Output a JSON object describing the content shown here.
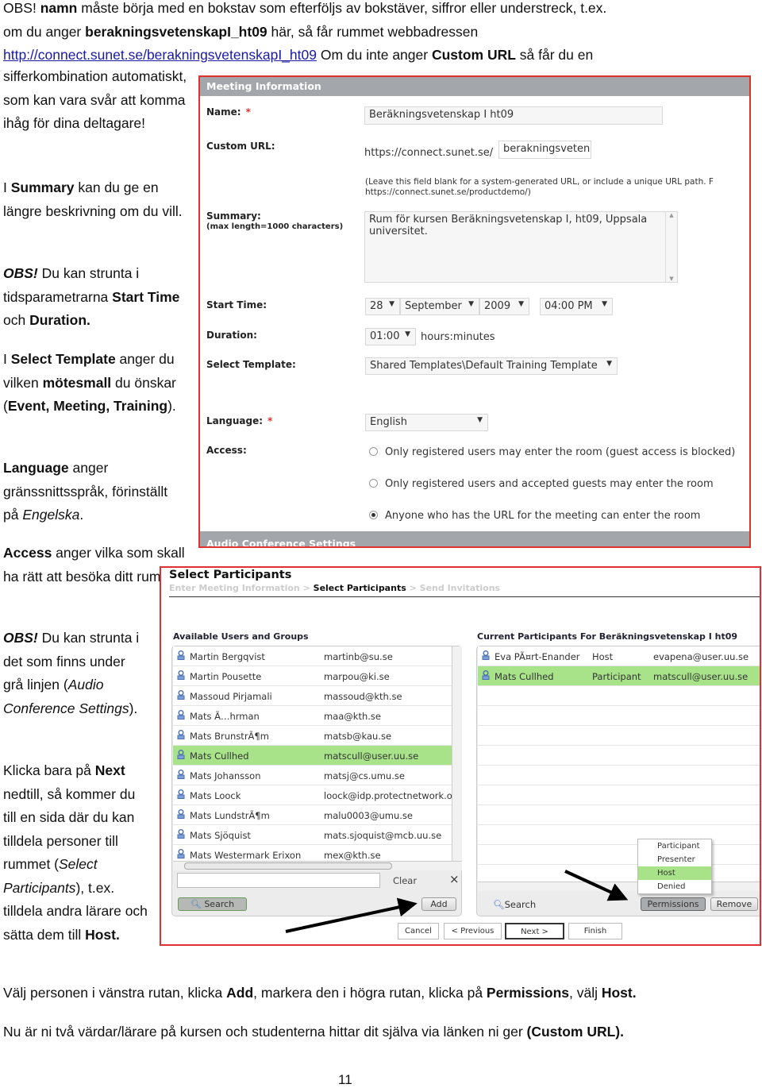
{
  "intro_top": [
    [
      {
        "t": "OBS! "
      },
      {
        "t": "namn",
        "b": true
      },
      {
        "t": " måste börja med en bokstav som efterföljs av bokstäver, siffror eller understreck, t.ex."
      }
    ],
    [
      {
        "t": "om du anger "
      },
      {
        "t": "berakningsvetenskapI_ht09",
        "b": true
      },
      {
        "t": " här, så får rummet webbadressen"
      }
    ],
    [
      {
        "t": "http://connect.sunet.se/berakningsvetenskapI_ht09",
        "link": true
      },
      {
        "t": "  Om du inte anger "
      },
      {
        "t": "Custom URL",
        "b": true
      },
      {
        "t": " så får du en"
      }
    ]
  ],
  "side_paragraphs": [
    [
      {
        "t": "sifferkombination automatiskt, som kan vara svår att komma ihåg för dina deltagare!"
      }
    ],
    [
      {
        "t": "I "
      },
      {
        "t": "Summary",
        "b": true
      },
      {
        "t": " kan du ge en längre beskrivning om du vill."
      }
    ],
    [
      {
        "t": "OBS!",
        "b": true,
        "i": true
      },
      {
        "t": " Du kan strunta i tidsparametrarna "
      },
      {
        "t": "Start Time",
        "b": true
      },
      {
        "t": " och "
      },
      {
        "t": "Duration.",
        "b": true
      }
    ],
    [
      {
        "t": "I "
      },
      {
        "t": "Select Template",
        "b": true
      },
      {
        "t": " anger du vilken "
      },
      {
        "t": "mötesmall",
        "b": true
      },
      {
        "t": " du önskar ("
      },
      {
        "t": "Event, Meeting, Training",
        "b": true
      },
      {
        "t": ")."
      }
    ],
    [
      {
        "t": "Language",
        "b": true
      },
      {
        "t": " anger gränssnittsspråk, förinställt på "
      },
      {
        "t": "Engelska",
        "i": true
      },
      {
        "t": "."
      }
    ],
    [
      {
        "t": "Access",
        "b": true
      },
      {
        "t": " anger vilka som skall ha rätt att besöka ditt rum."
      }
    ],
    [
      {
        "t": "OBS!",
        "b": true,
        "i": true
      },
      {
        "t": " Du kan strunta i det som finns under grå linjen ("
      },
      {
        "t": "Audio Conference Settings",
        "i": true
      },
      {
        "t": ")."
      }
    ],
    [
      {
        "t": "Klicka bara på "
      },
      {
        "t": "Next",
        "b": true
      },
      {
        "t": " nedtill, så kommer du till en sida där du kan tilldela personer till rummet ("
      },
      {
        "t": "Select Participants",
        "i": true
      },
      {
        "t": "), t.ex. tilldela andra lärare och sätta dem till "
      },
      {
        "t": "Host.",
        "b": true
      }
    ]
  ],
  "bottom_paragraphs": [
    [
      {
        "t": "Välj personen i vänstra rutan, klicka "
      },
      {
        "t": "Add",
        "b": true
      },
      {
        "t": ", markera den i högra rutan, klicka på "
      },
      {
        "t": "Permissions",
        "b": true
      },
      {
        "t": ", välj "
      },
      {
        "t": "Host.",
        "b": true
      }
    ],
    [
      {
        "t": "Nu är ni två värdar/lärare på kursen och studenterna hittar dit själva via länken ni ger "
      },
      {
        "t": "(Custom URL).",
        "b": true
      }
    ]
  ],
  "page_number": "11",
  "meeting": {
    "header": "Meeting Information",
    "name_label": "Name:",
    "required": "*",
    "name_value": "Beräkningsvetenskap I ht09",
    "url_label": "Custom URL:",
    "url_prefix": "https://connect.sunet.se/",
    "url_value": "berakningsveten",
    "url_help_1": "(Leave this field blank for a system-generated URL, or include a unique URL path. F",
    "url_help_2": "https://connect.sunet.se/productdemo/)",
    "summary_label": "Summary:",
    "summary_hint": "(max length=1000 characters)",
    "summary_value": "Rum för kursen Beräkningsvetenskap I, ht09, Uppsala universitet.",
    "start_label": "Start Time:",
    "start_day": "28",
    "start_month": "September",
    "start_year": "2009",
    "start_time": "04:00 PM",
    "duration_label": "Duration:",
    "duration_value": "01:00",
    "duration_unit": "hours:minutes",
    "template_label": "Select Template:",
    "template_value": "Shared Templates\\Default Training Template",
    "language_label": "Language:",
    "language_value": "English",
    "access_label": "Access:",
    "access_options": [
      {
        "label": "Only registered users may enter the room (guest access is blocked)",
        "selected": false
      },
      {
        "label": "Only registered users and accepted guests may enter the room",
        "selected": false
      },
      {
        "label": "Anyone who has the URL for the meeting can enter the room",
        "selected": true
      }
    ],
    "audio_header": "Audio Conference Settings"
  },
  "participants": {
    "title": "Select Participants",
    "breadcrumb": [
      "Enter Meeting Information",
      "Select Participants",
      "Send Invitations"
    ],
    "breadcrumb_sep": ">",
    "available_title": "Available Users and Groups",
    "available": [
      {
        "name": "Martin Bergqvist",
        "email": "martinb@su.se"
      },
      {
        "name": "Martin Pousette",
        "email": "marpou@ki.se"
      },
      {
        "name": "Massoud Pirjamali",
        "email": "massoud@kth.se"
      },
      {
        "name": "Mats Ã…hrman",
        "email": "maa@kth.se"
      },
      {
        "name": "Mats BrunstrÃ¶m",
        "email": "matsb@kau.se"
      },
      {
        "name": "Mats Cullhed",
        "email": "matscull@user.uu.se",
        "selected": true
      },
      {
        "name": "Mats Johansson",
        "email": "matsj@cs.umu.se"
      },
      {
        "name": "Mats Loock",
        "email": "loock@idp.protectnetwork.org"
      },
      {
        "name": "Mats LundstrÃ¶m",
        "email": "malu0003@umu.se"
      },
      {
        "name": "Mats Sjöquist",
        "email": "mats.sjoquist@mcb.uu.se"
      },
      {
        "name": "Mats Westermark Erixon",
        "email": "mex@kth.se"
      }
    ],
    "search_placeholder": "",
    "clear_label": "Clear",
    "clear_x": "×",
    "search_label": "Search",
    "add_label": "Add",
    "current_title": "Current Participants For Beräkningsvetenskap I ht09",
    "current": [
      {
        "name": "Eva PÃ¤rt-Enander",
        "role": "Host",
        "email": "evapena@user.uu.se"
      },
      {
        "name": "Mats Cullhed",
        "role": "Participant",
        "email": "matscull@user.uu.se",
        "selected": true
      }
    ],
    "permission_menu": [
      {
        "label": "Participant"
      },
      {
        "label": "Presenter"
      },
      {
        "label": "Host",
        "selected": true
      },
      {
        "label": "Denied"
      }
    ],
    "current_search_label": "Search",
    "permissions_label": "Permissions",
    "remove_label": "Remove",
    "nav": {
      "cancel": "Cancel",
      "previous": "< Previous",
      "next": "Next >",
      "finish": "Finish"
    }
  },
  "colors": {
    "highlight": "#a8e38a",
    "frame": "#e03030",
    "header_gray": "#a3a7ab",
    "link": "#1a1aa6"
  }
}
